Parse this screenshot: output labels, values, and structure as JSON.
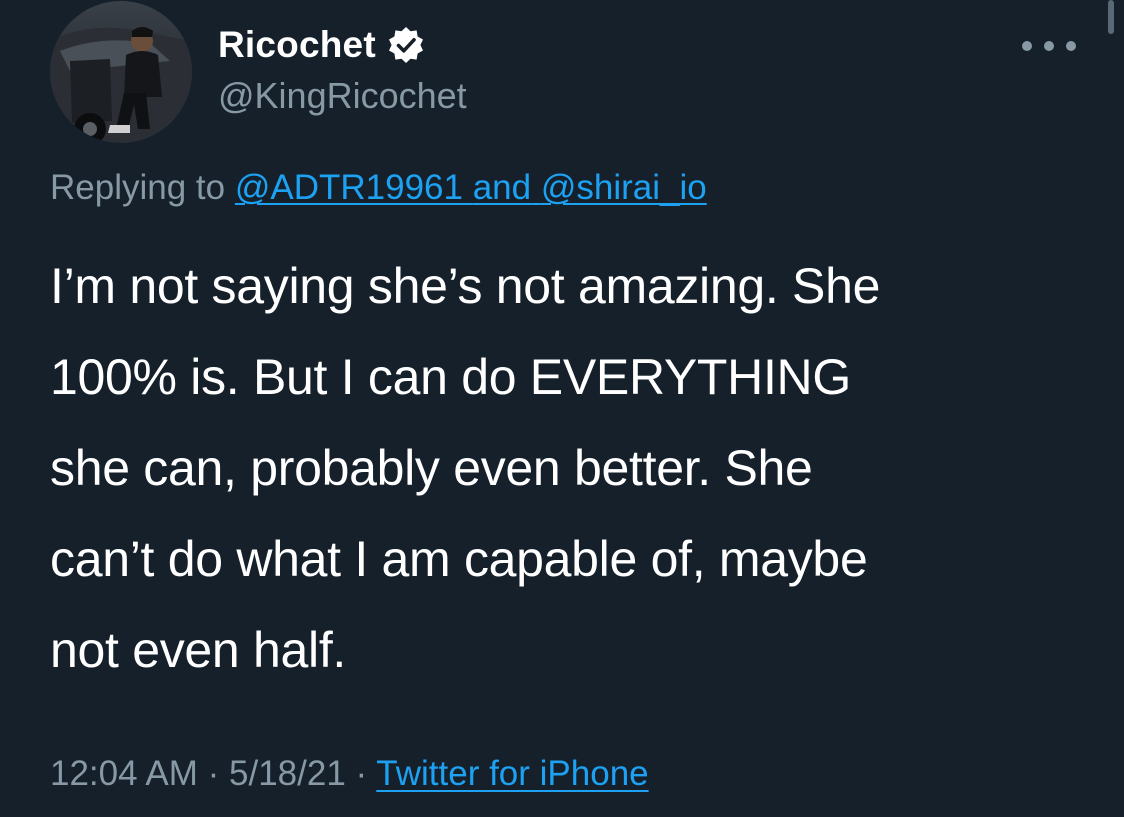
{
  "author": {
    "name": "Ricochet",
    "handle": "@KingRicochet",
    "verified": true,
    "avatar_icon": "user-avatar-photo"
  },
  "menu": {
    "more_icon": "more-options-icon"
  },
  "reply": {
    "prefix": "Replying to",
    "mention_1": "@ADTR19961",
    "joiner": "and",
    "mention_2": "@shirai_io"
  },
  "tweet": {
    "text": "I’m not saying she’s not amazing. She\n100% is. But I can do EVERYTHING\nshe can, probably even better. She\ncan’t do what I am capable of, maybe\nnot even half."
  },
  "meta": {
    "time": "12:04 AM",
    "separator": "·",
    "date": "5/18/21",
    "source": "Twitter for iPhone"
  },
  "colors": {
    "background": "#15202b",
    "primary_text": "#ffffff",
    "secondary_text": "#8899a6",
    "link": "#1da1f2"
  }
}
